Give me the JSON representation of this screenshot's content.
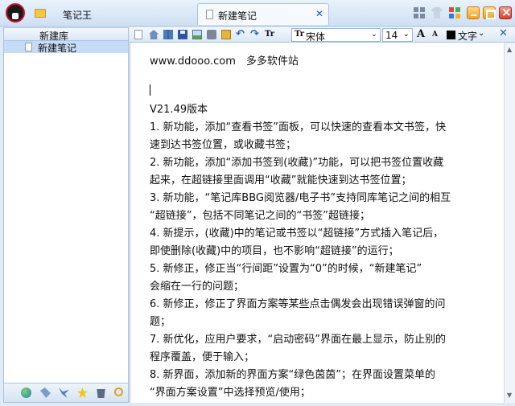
{
  "titlebar": {
    "app_title": "笔记王",
    "tab_label": "新建笔记",
    "tab_close": "✕"
  },
  "sidebar": {
    "library_label": "新建库",
    "items": [
      {
        "label": "新建笔记"
      }
    ]
  },
  "toolbar": {
    "undo_glyph": "↶",
    "redo_glyph": "↷",
    "font_icon_glyph": "Tr",
    "font_face_glyph": "Tr",
    "font_name": "宋体",
    "font_size": "14",
    "dropdown_glyph": "⌄",
    "grow_glyph": "A",
    "shrink_glyph": "A",
    "color_label": "文字",
    "close_glyph": "✕"
  },
  "editor": {
    "lines": [
      "www.ddooo.com　多多软件站",
      "",
      "V21.49版本",
      "1. 新功能，添加“查看书签”面板，可以快速的查看本文书签，快",
      "速到达书签位置，或收藏书签；",
      "2. 新功能，添加“添加书签到(收藏)”功能，可以把书签位置收藏",
      "起来，在超链接里面调用“收藏”就能快速到达书签位置；",
      "3. 新功能，“笔记库BBG阅览器/电子书”支持同库笔记之间的相互",
      "“超链接”，包括不同笔记之间的“书签”超链接；",
      "4. 新提示，(收藏)中的笔记或书签以“超链接”方式插入笔记后，",
      "即使删除(收藏)中的项目，也不影响“超链接”的运行；",
      "5. 新修正，修正当“行间距”设置为“0”的时候，“新建笔记”",
      "会缩在一行的问题；",
      "6. 新修正，修正了界面方案等某些点击偶发会出现错误弹窗的问",
      "题；",
      "7. 新优化，应用户要求，“启动密码”界面在最上显示，防止别的",
      "程序覆盖，便于输入；",
      "8. 新界面，添加新的界面方案“绿色茵茵”；在界面设置菜单的",
      "“界面方案设置”中选择预览/使用；",
      "……"
    ]
  },
  "scrollbar": {
    "up": "▲",
    "down": "▼"
  }
}
